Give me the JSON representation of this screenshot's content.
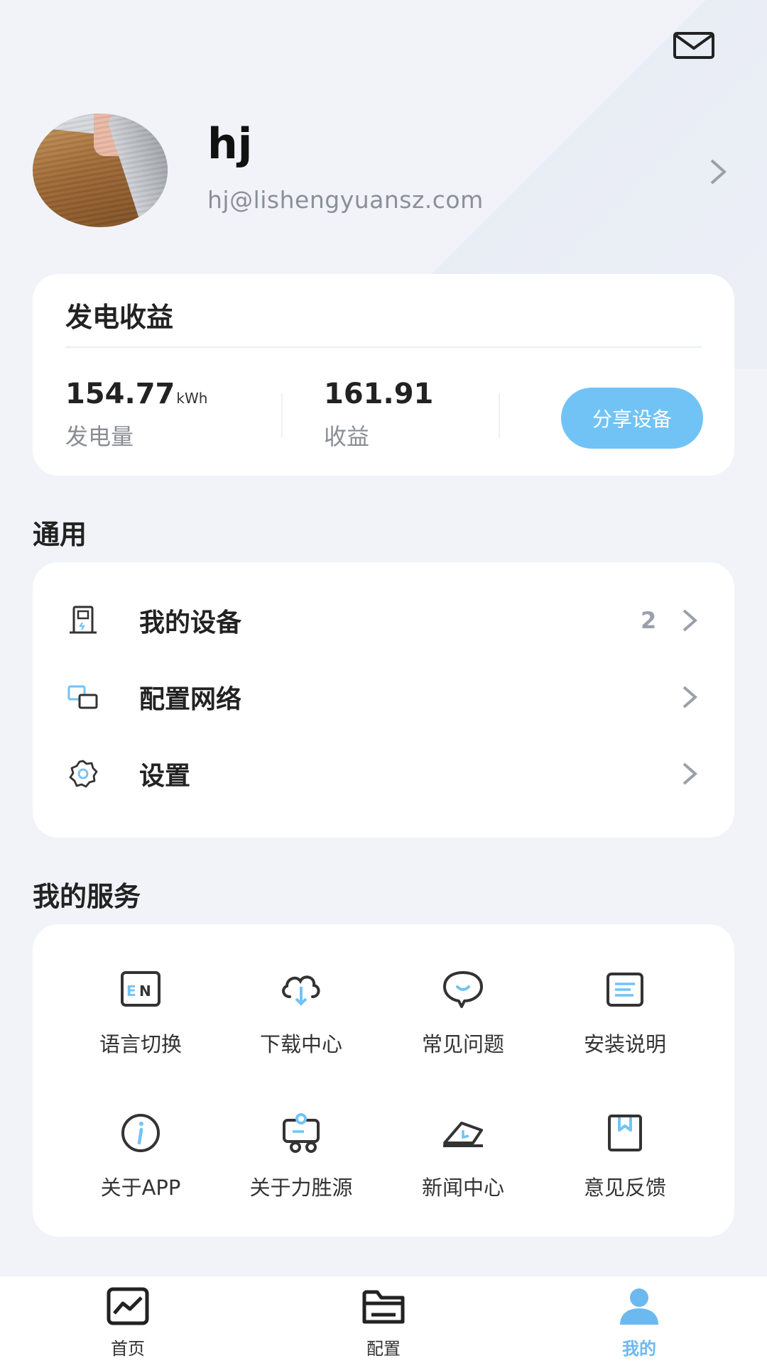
{
  "profile": {
    "name": "hj",
    "email": "hj@lishengyuansz.com"
  },
  "earnings": {
    "title": "发电收益",
    "energy_value": "154.77",
    "energy_unit": "kWh",
    "energy_label": "发电量",
    "income_value": "161.91",
    "income_label": "收益",
    "share_button": "分享设备"
  },
  "general": {
    "title": "通用",
    "items": [
      {
        "label": "我的设备",
        "count": "2",
        "icon": "device-icon"
      },
      {
        "label": "配置网络",
        "icon": "network-config-icon"
      },
      {
        "label": "设置",
        "icon": "gear-icon"
      }
    ]
  },
  "services": {
    "title": "我的服务",
    "items": [
      {
        "label": "语言切换",
        "icon": "language-en-icon"
      },
      {
        "label": "下载中心",
        "icon": "cloud-download-icon"
      },
      {
        "label": "常见问题",
        "icon": "chat-bubble-icon"
      },
      {
        "label": "安装说明",
        "icon": "document-icon"
      },
      {
        "label": "关于APP",
        "icon": "info-icon"
      },
      {
        "label": "关于力胜源",
        "icon": "company-icon"
      },
      {
        "label": "新闻中心",
        "icon": "news-icon"
      },
      {
        "label": "意见反馈",
        "icon": "bookmark-icon"
      }
    ]
  },
  "tabbar": {
    "items": [
      {
        "label": "首页",
        "icon": "chart-icon"
      },
      {
        "label": "配置",
        "icon": "folder-icon"
      },
      {
        "label": "我的",
        "icon": "user-icon",
        "active": true
      }
    ]
  },
  "colors": {
    "accent": "#72c3f5",
    "active_tab": "#6cb9f0",
    "background": "#f1f3f8"
  }
}
